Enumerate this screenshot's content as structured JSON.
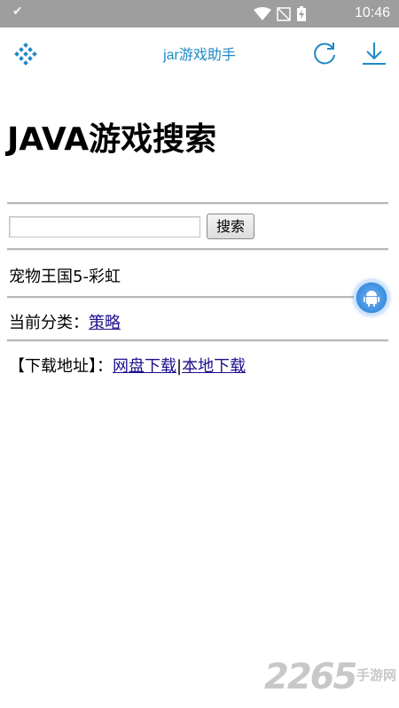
{
  "status_bar": {
    "time": "10:46",
    "icons": [
      "check-icon",
      "wifi-icon",
      "no-signal-icon",
      "battery-charging-icon"
    ]
  },
  "app_bar": {
    "title": "jar游戏助手",
    "icons": [
      "grid-menu-icon",
      "refresh-icon",
      "download-icon"
    ],
    "accent_color": "#1f88c8"
  },
  "main": {
    "page_title": "JAVA游戏搜索",
    "search": {
      "input_value": "",
      "button_label": "搜索"
    },
    "game_name": "宠物王国5-彩虹",
    "category": {
      "label": "当前分类：",
      "value": "策略"
    },
    "download": {
      "label": "【下载地址】：",
      "links": [
        "网盘下载",
        "本地下载"
      ],
      "separator": "|"
    }
  },
  "watermark": {
    "number": "2265",
    "suffix": "手游网"
  }
}
